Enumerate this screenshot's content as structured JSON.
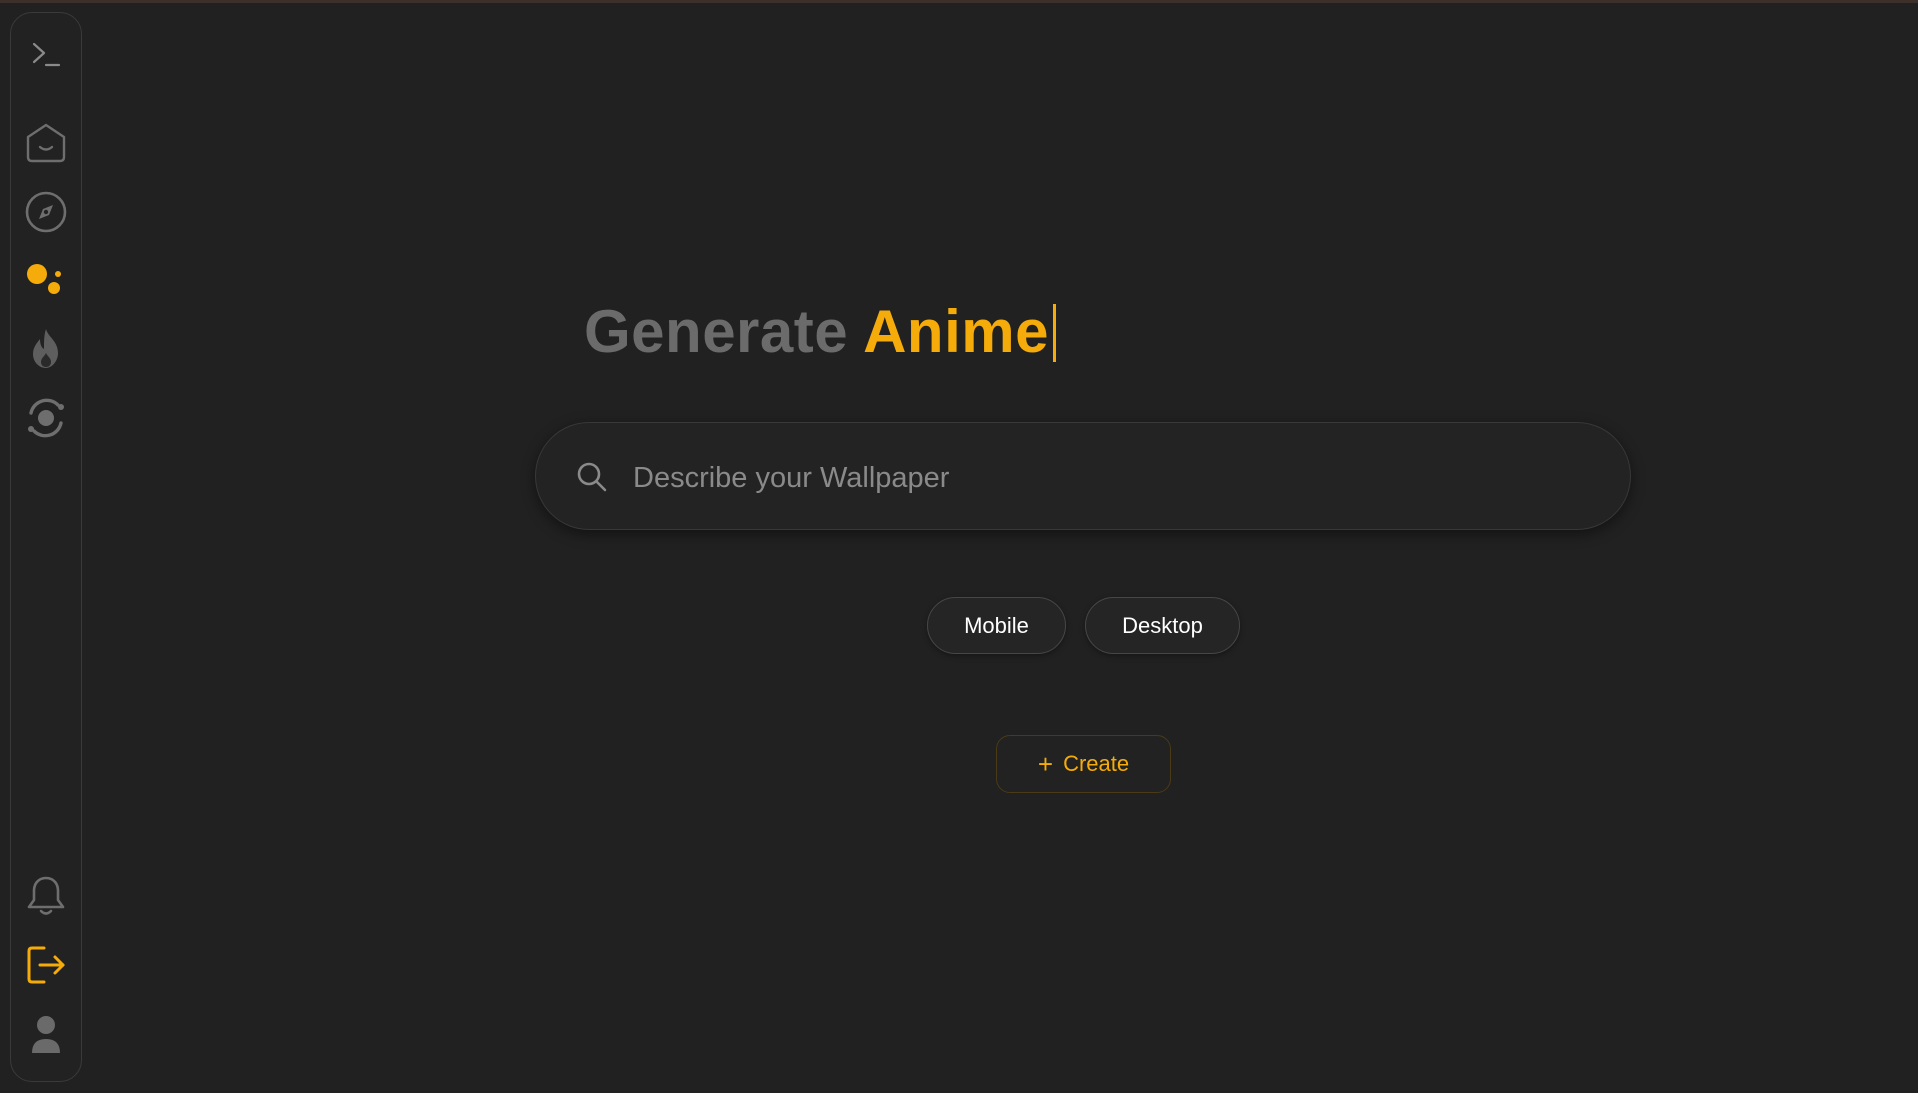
{
  "sidebar": {
    "items": [
      {
        "name": "terminal-icon"
      },
      {
        "name": "home-icon"
      },
      {
        "name": "compass-icon"
      },
      {
        "name": "dots-cluster-icon",
        "active": true
      },
      {
        "name": "flame-icon"
      },
      {
        "name": "orbit-icon"
      },
      {
        "name": "bell-icon"
      },
      {
        "name": "logout-icon"
      },
      {
        "name": "user-icon"
      }
    ]
  },
  "hero": {
    "static_text": "Generate",
    "typed_word": "Anime"
  },
  "search": {
    "placeholder": "Describe your Wallpaper",
    "value": ""
  },
  "device_options": {
    "mobile_label": "Mobile",
    "desktop_label": "Desktop"
  },
  "create_button": {
    "icon": "+",
    "label": "Create"
  },
  "colors": {
    "background": "#212121",
    "accent": "#f5ac0b",
    "muted_text": "#6b6b6b"
  }
}
